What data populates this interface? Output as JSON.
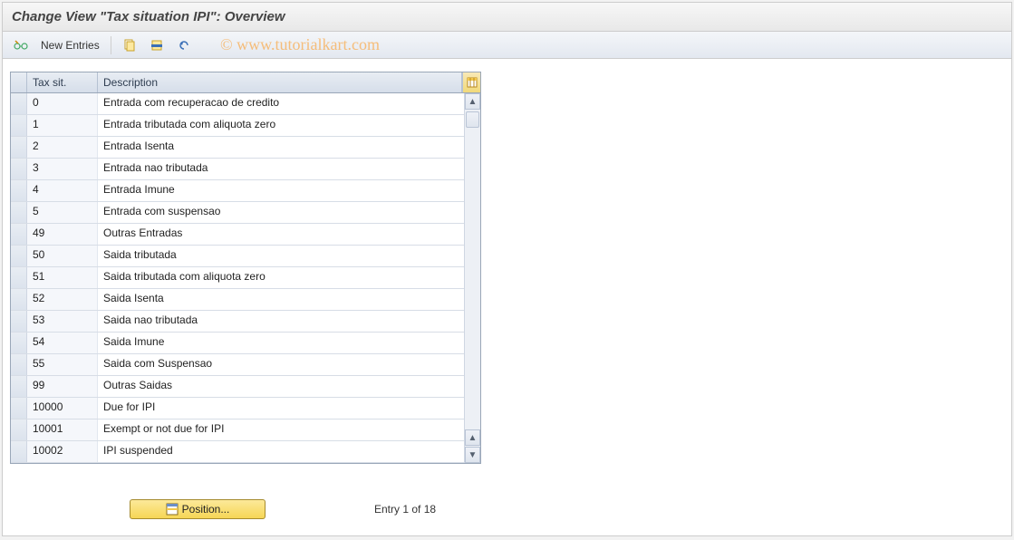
{
  "title": "Change View \"Tax situation IPI\": Overview",
  "watermark": "© www.tutorialkart.com",
  "toolbar": {
    "new_entries": "New Entries"
  },
  "table": {
    "headers": {
      "code": "Tax sit.",
      "desc": "Description"
    },
    "rows": [
      {
        "code": "0",
        "desc": "Entrada com recuperacao de credito"
      },
      {
        "code": "1",
        "desc": "Entrada tributada com aliquota zero"
      },
      {
        "code": "2",
        "desc": "Entrada Isenta"
      },
      {
        "code": "3",
        "desc": "Entrada nao tributada"
      },
      {
        "code": "4",
        "desc": "Entrada Imune"
      },
      {
        "code": "5",
        "desc": "Entrada com suspensao"
      },
      {
        "code": "49",
        "desc": "Outras Entradas"
      },
      {
        "code": "50",
        "desc": "Saida tributada"
      },
      {
        "code": "51",
        "desc": "Saida tributada com aliquota zero"
      },
      {
        "code": "52",
        "desc": "Saida Isenta"
      },
      {
        "code": "53",
        "desc": "Saida nao tributada"
      },
      {
        "code": "54",
        "desc": "Saida Imune"
      },
      {
        "code": "55",
        "desc": "Saida com Suspensao"
      },
      {
        "code": "99",
        "desc": "Outras Saidas"
      },
      {
        "code": "10000",
        "desc": "Due for IPI"
      },
      {
        "code": "10001",
        "desc": "Exempt or not due for IPI"
      },
      {
        "code": "10002",
        "desc": "IPI suspended"
      }
    ]
  },
  "footer": {
    "position_label": "Position...",
    "entry_label": "Entry 1 of 18"
  }
}
